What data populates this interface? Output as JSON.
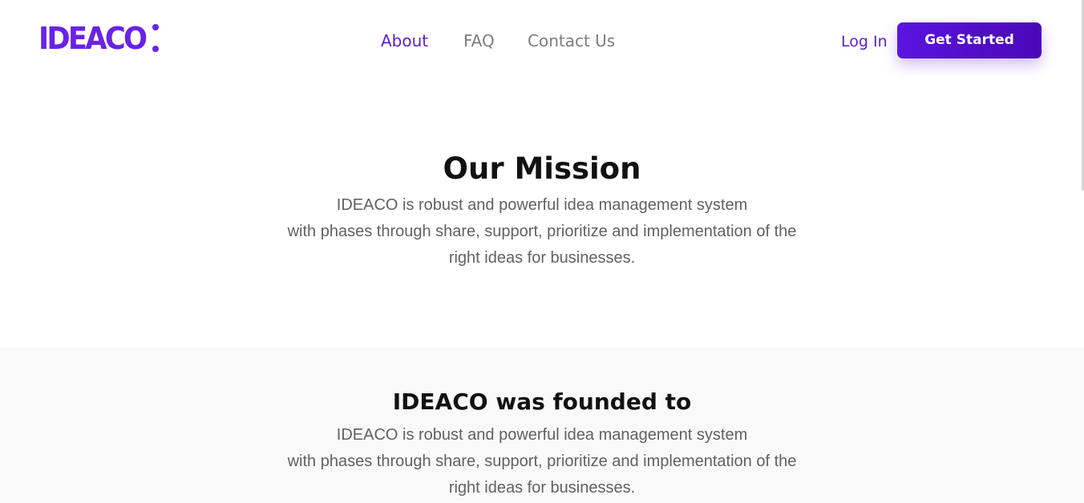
{
  "brand": {
    "logo_text": "IDEACO",
    "accent_color": "#6a22e6",
    "cta_color": "#5a14e0"
  },
  "nav": {
    "items": [
      {
        "label": "About",
        "active": true
      },
      {
        "label": "FAQ",
        "active": false
      },
      {
        "label": "Contact Us",
        "active": false
      }
    ]
  },
  "header": {
    "login_label": "Log In",
    "cta_label": "Get Started"
  },
  "mission": {
    "title": "Our Mission",
    "lines": [
      "IDEACO is robust and powerful idea management system",
      "with phases through share, support, prioritize and implementation of the",
      "right ideas for businesses."
    ]
  },
  "founded": {
    "title": "IDEACO was founded to",
    "lines": [
      "IDEACO is robust and powerful idea management system",
      "with phases through share, support, prioritize and implementation of the",
      "right ideas for businesses."
    ]
  }
}
